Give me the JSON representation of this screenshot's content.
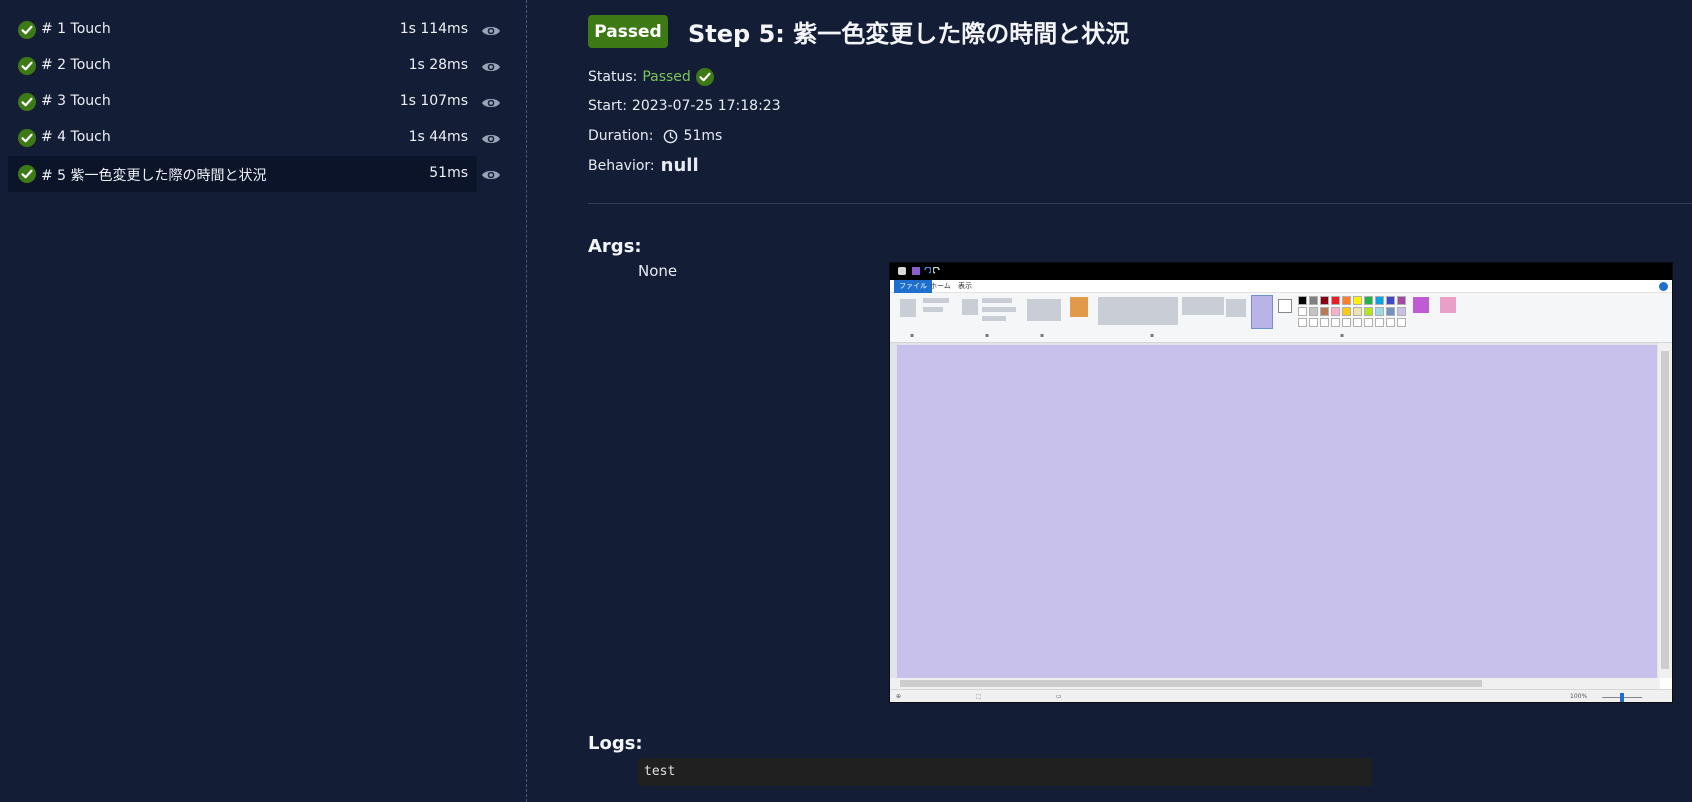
{
  "sidebar": {
    "steps": [
      {
        "label": "# 1 Touch",
        "duration": "1s 114ms",
        "status": "passed"
      },
      {
        "label": "# 2 Touch",
        "duration": "1s 28ms",
        "status": "passed"
      },
      {
        "label": "# 3 Touch",
        "duration": "1s 107ms",
        "status": "passed"
      },
      {
        "label": "# 4 Touch",
        "duration": "1s 44ms",
        "status": "passed"
      },
      {
        "label": "# 5 紫一色変更した際の時間と状況",
        "duration": "51ms",
        "status": "passed",
        "selected": true
      }
    ]
  },
  "detail": {
    "badge": "Passed",
    "title": "Step 5: 紫一色変更した際の時間と状況",
    "status_label": "Status:",
    "status_value": "Passed",
    "start_label": "Start:",
    "start_value": "2023-07-25 17:18:23",
    "duration_label": "Duration:",
    "duration_value": "51ms",
    "behavior_label": "Behavior:",
    "behavior_value": "null",
    "args_title": "Args:",
    "args_value": "None",
    "logs_title": "Logs:",
    "log_text": "test"
  },
  "screenshot": {
    "menu": [
      "ファイル",
      "ホーム",
      "表示"
    ],
    "status_size": "100%",
    "canvas_color": "#c8c1eb"
  },
  "colors": {
    "background": "#131d36",
    "passed_green": "#3d7a15",
    "status_green": "#7cc55d",
    "selected_row": "#0b1429"
  },
  "icons": {
    "step_status": "check-circle-icon",
    "view": "eye-icon",
    "duration": "clock-icon"
  }
}
